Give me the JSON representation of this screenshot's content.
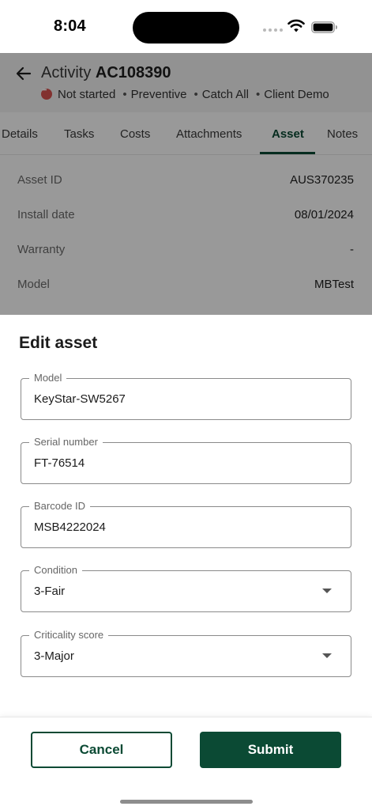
{
  "status_bar": {
    "time": "8:04"
  },
  "header": {
    "title_prefix": "Activity",
    "title_id": "AC108390",
    "status": "Not started",
    "tags": [
      "Preventive",
      "Catch All",
      "Client Demo"
    ]
  },
  "tabs": [
    {
      "label": "Details",
      "active": false
    },
    {
      "label": "Tasks",
      "active": false
    },
    {
      "label": "Costs",
      "active": false
    },
    {
      "label": "Attachments",
      "active": false
    },
    {
      "label": "Asset",
      "active": true
    },
    {
      "label": "Notes",
      "active": false
    }
  ],
  "asset_details": [
    {
      "key": "Asset ID",
      "value": "AUS370235"
    },
    {
      "key": "Install date",
      "value": "08/01/2024"
    },
    {
      "key": "Warranty",
      "value": "-"
    },
    {
      "key": "Model",
      "value": "MBTest"
    }
  ],
  "sheet": {
    "title": "Edit asset",
    "fields": [
      {
        "label": "Model",
        "value": "KeyStar-SW5267",
        "type": "text"
      },
      {
        "label": "Serial number",
        "value": "FT-76514",
        "type": "text"
      },
      {
        "label": "Barcode ID",
        "value": "MSB4222024",
        "type": "text"
      },
      {
        "label": "Condition",
        "value": "3-Fair",
        "type": "select"
      },
      {
        "label": "Criticality score",
        "value": "3-Major",
        "type": "select"
      }
    ],
    "cancel_label": "Cancel",
    "submit_label": "Submit"
  },
  "colors": {
    "primary": "#0b4a34",
    "status_not_started": "#d9534f",
    "scrim": "rgba(0,0,0,0.40)"
  },
  "icons": [
    "back-arrow-icon",
    "cellular-signal-icon",
    "wifi-icon",
    "battery-icon",
    "dropdown-caret-icon",
    "not-started-status-icon"
  ]
}
